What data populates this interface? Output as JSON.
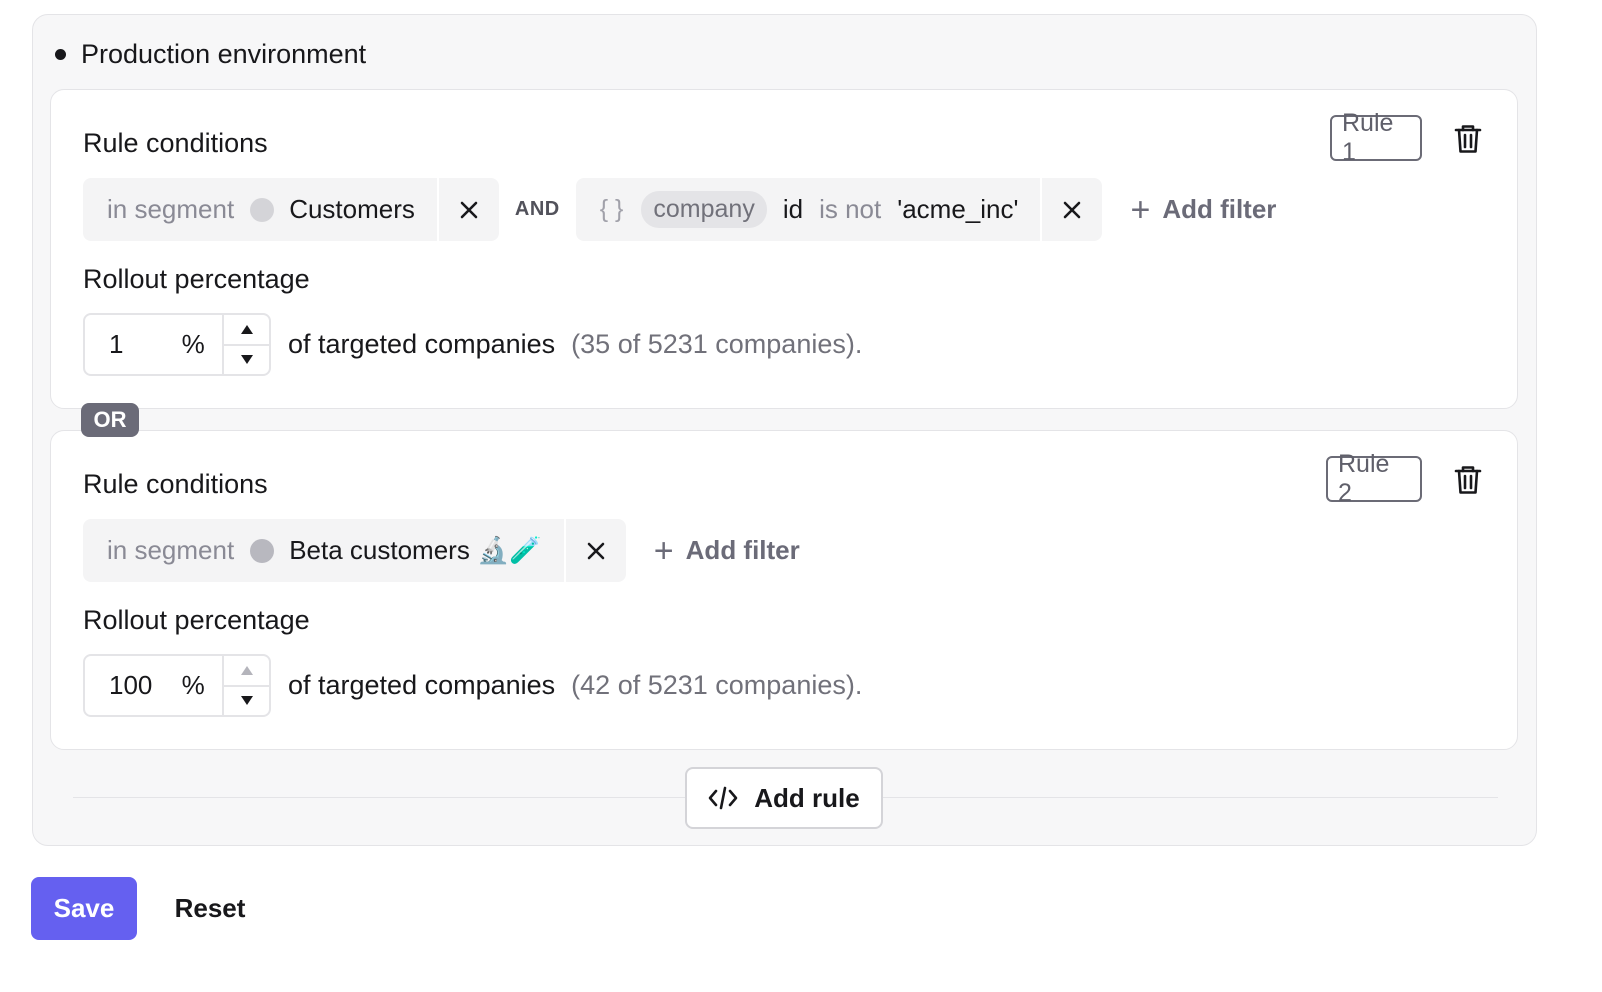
{
  "environment": {
    "title": "Production environment"
  },
  "rules": [
    {
      "badge": "Rule 1",
      "conditions_title": "Rule conditions",
      "segment_filter": {
        "prefix": "in segment",
        "segment": "Customers"
      },
      "connector": "AND",
      "attribute_filter": {
        "braces": "{ }",
        "entity": "company",
        "field": "id",
        "operator": "is not",
        "value": "'acme_inc'"
      },
      "add_filter_label": "Add filter",
      "rollout_title": "Rollout percentage",
      "rollout_value": "1",
      "rollout_unit": "%",
      "rollout_text": "of targeted companies",
      "rollout_count": "(35 of 5231 companies)."
    },
    {
      "badge": "Rule 2",
      "conditions_title": "Rule conditions",
      "segment_filter": {
        "prefix": "in segment",
        "segment": "Beta customers 🔬🧪"
      },
      "add_filter_label": "Add filter",
      "rollout_title": "Rollout percentage",
      "rollout_value": "100",
      "rollout_unit": "%",
      "rollout_text": "of targeted companies",
      "rollout_count": "(42 of 5231 companies)."
    }
  ],
  "or_label": "OR",
  "add_rule_label": "Add rule",
  "actions": {
    "save_label": "Save",
    "reset_label": "Reset"
  },
  "icons": {
    "trash": "trash-icon",
    "close": "close-icon",
    "plus": "plus-icon",
    "code": "code-icon",
    "arrow_up": "arrow-up-icon",
    "arrow_down": "arrow-down-icon"
  },
  "colors": {
    "accent": "#6560f0",
    "or_badge": "#6b6b78"
  }
}
